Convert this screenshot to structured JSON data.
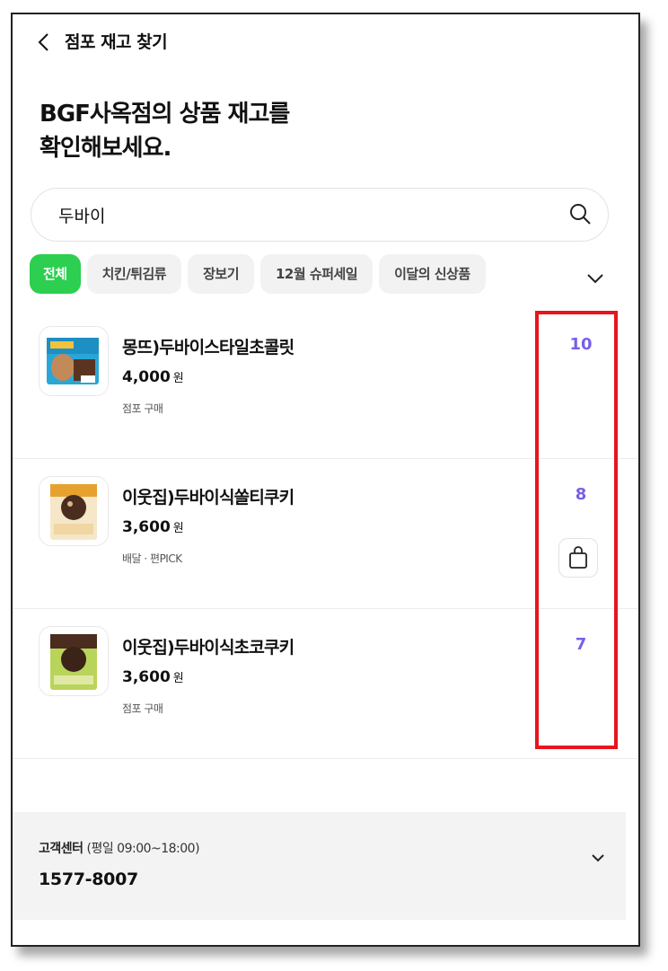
{
  "header": {
    "title": "점포 재고 찾기"
  },
  "page": {
    "title_line1": "BGF사옥점의 상품 재고를",
    "title_line2": "확인해보세요."
  },
  "search": {
    "value": "두바이",
    "placeholder": ""
  },
  "categories": {
    "items": [
      {
        "label": "전체",
        "active": true
      },
      {
        "label": "치킨/튀김류",
        "active": false
      },
      {
        "label": "장보기",
        "active": false
      },
      {
        "label": "12월 슈퍼세일",
        "active": false
      },
      {
        "label": "이달의 신상품",
        "active": false
      }
    ]
  },
  "products": [
    {
      "name": "몽뜨)두바이스타일초콜릿",
      "price": "4,000",
      "price_unit": "원",
      "sub": "점포 구매",
      "stock": "10",
      "pickup_icon": false
    },
    {
      "name": "이웃집)두바이식쏠티쿠키",
      "price": "3,600",
      "price_unit": "원",
      "sub": "배달 · 편PICK",
      "stock": "8",
      "pickup_icon": true
    },
    {
      "name": "이웃집)두바이식초코쿠키",
      "price": "3,600",
      "price_unit": "원",
      "sub": "점포 구매",
      "stock": "7",
      "pickup_icon": false
    }
  ],
  "footer": {
    "label": "고객센터",
    "hours": "(평일 09:00~18:00)",
    "phone": "1577-8007"
  },
  "colors": {
    "accent_green": "#2ccf4f",
    "stock_purple": "#7a5ee6",
    "highlight_red": "#e8141e"
  },
  "icons": {
    "back": "chevron-left-icon",
    "search": "search-icon",
    "expand": "chevron-down-icon",
    "bag": "shopping-bag-icon"
  }
}
